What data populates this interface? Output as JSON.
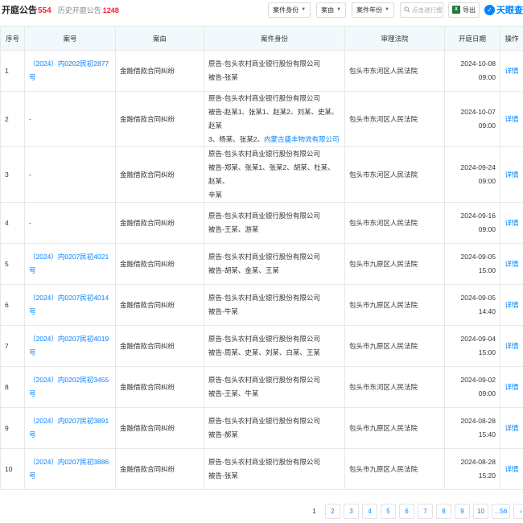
{
  "header": {
    "title": "开庭公告",
    "title_count": "554",
    "history_label": "历史开庭公告",
    "history_count": "1248",
    "filters": [
      "案件身份",
      "案由",
      "案件年份"
    ],
    "search_placeholder": "点击进行搜索",
    "export_label": "导出",
    "logo_text": "天眼查"
  },
  "table": {
    "columns": [
      "序号",
      "案号",
      "案由",
      "案件身份",
      "审理法院",
      "开庭日期",
      "操作"
    ],
    "rows": [
      {
        "idx": "1",
        "case_no": "（2024）内0202民初2877号",
        "cause": "金融借款合同纠纷",
        "parties": [
          {
            "text": "原告-包头农村商业银行股份有限公司"
          },
          {
            "text": "被告-张某"
          }
        ],
        "court": "包头市东河区人民法院",
        "date": "2024-10-08 09:00",
        "op": "详情"
      },
      {
        "idx": "2",
        "case_no": "-",
        "cause": "金融借款合同纠纷",
        "parties": [
          {
            "text": "原告-包头农村商业银行股份有限公司"
          },
          {
            "text": "被告-赵某1、张某1、赵某2、刘某、史某、赵某"
          },
          {
            "text": "3、杨某、张某2、",
            "link": "内蒙古盛丰物流有限公司"
          }
        ],
        "court": "包头市东河区人民法院",
        "date": "2024-10-07 09:00",
        "op": "详情"
      },
      {
        "idx": "3",
        "case_no": "-",
        "cause": "金融借款合同纠纷",
        "parties": [
          {
            "text": "原告-包头农村商业银行股份有限公司"
          },
          {
            "text": "被告-郑某、张某1、张某2、胡某、杜某、赵某、"
          },
          {
            "text": "辛某"
          }
        ],
        "court": "包头市东河区人民法院",
        "date": "2024-09-24 09:00",
        "op": "详情"
      },
      {
        "idx": "4",
        "case_no": "-",
        "cause": "金融借款合同纠纷",
        "parties": [
          {
            "text": "原告-包头农村商业银行股份有限公司"
          },
          {
            "text": "被告-王某、游某"
          }
        ],
        "court": "包头市东河区人民法院",
        "date": "2024-09-16 09:00",
        "op": "详情"
      },
      {
        "idx": "5",
        "case_no": "（2024）内0207民初4021号",
        "cause": "金融借款合同纠纷",
        "parties": [
          {
            "text": "原告-包头农村商业银行股份有限公司"
          },
          {
            "text": "被告-胡某、金某、王某"
          }
        ],
        "court": "包头市九原区人民法院",
        "date": "2024-09-05 15:00",
        "op": "详情"
      },
      {
        "idx": "6",
        "case_no": "（2024）内0207民初4014号",
        "cause": "金融借款合同纠纷",
        "parties": [
          {
            "text": "原告-包头农村商业银行股份有限公司"
          },
          {
            "text": "被告-牛某"
          }
        ],
        "court": "包头市九原区人民法院",
        "date": "2024-09-05 14:40",
        "op": "详情"
      },
      {
        "idx": "7",
        "case_no": "（2024）内0207民初4019号",
        "cause": "金融借款合同纠纷",
        "parties": [
          {
            "text": "原告-包头农村商业银行股份有限公司"
          },
          {
            "text": "被告-周某、史某、刘某、白某、王某"
          }
        ],
        "court": "包头市九原区人民法院",
        "date": "2024-09-04 15:00",
        "op": "详情"
      },
      {
        "idx": "8",
        "case_no": "（2024）内0202民初3455号",
        "cause": "金融借款合同纠纷",
        "parties": [
          {
            "text": "原告-包头农村商业银行股份有限公司"
          },
          {
            "text": "被告-王某、牛某"
          }
        ],
        "court": "包头市东河区人民法院",
        "date": "2024-09-02 09:00",
        "op": "详情"
      },
      {
        "idx": "9",
        "case_no": "（2024）内0207民初3891号",
        "cause": "金融借款合同纠纷",
        "parties": [
          {
            "text": "原告-包头农村商业银行股份有限公司"
          },
          {
            "text": "被告-郝某"
          }
        ],
        "court": "包头市九原区人民法院",
        "date": "2024-08-28 15:40",
        "op": "详情"
      },
      {
        "idx": "10",
        "case_no": "（2024）内0207民初3886号",
        "cause": "金融借款合同纠纷",
        "parties": [
          {
            "text": "原告-包头农村商业银行股份有限公司"
          },
          {
            "text": "被告-张某"
          }
        ],
        "court": "包头市九原区人民法院",
        "date": "2024-08-28 15:20",
        "op": "详情"
      }
    ]
  },
  "pagination": {
    "current": "1",
    "pages": [
      "1",
      "2",
      "3",
      "4",
      "5",
      "6",
      "7",
      "8",
      "9",
      "10",
      "...56"
    ],
    "next": "›"
  }
}
